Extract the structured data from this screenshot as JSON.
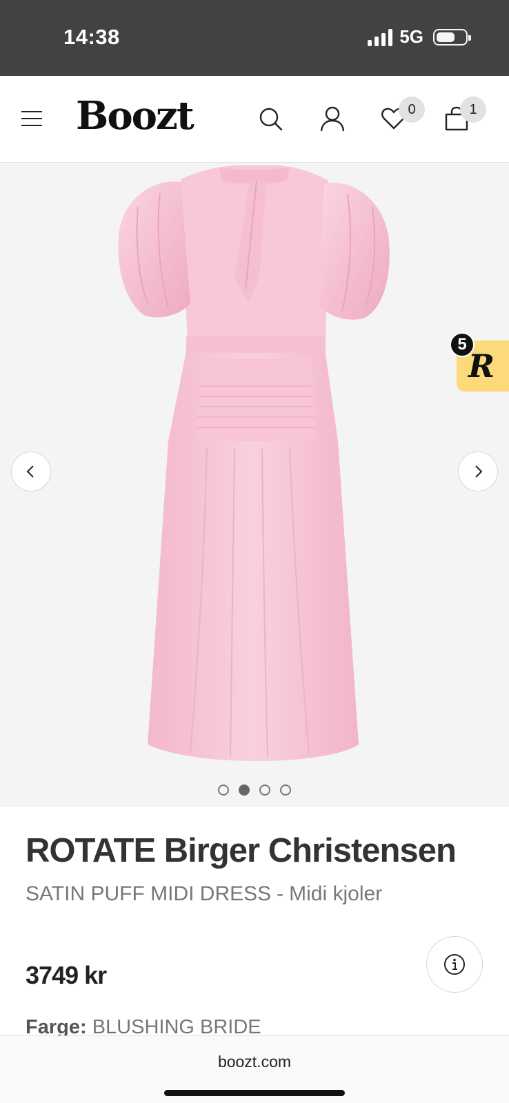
{
  "status_bar": {
    "time": "14:38",
    "network": "5G",
    "battery_level": 0.55
  },
  "header": {
    "logo": "Boozt",
    "wishlist_count": "0",
    "cart_count": "1"
  },
  "gallery": {
    "image_description_icon": "pink-satin-puff-sleeve-dress",
    "dots_total": 4,
    "active_index": 2,
    "reward_count": "5",
    "reward_letter": "R"
  },
  "product": {
    "brand": "ROTATE Birger Christensen",
    "name": "SATIN PUFF MIDI DRESS",
    "separator": "-",
    "category": "Midi kjoler",
    "price": "3749 kr",
    "color_label": "Farge:",
    "color_value": "BLUSHING BRIDE"
  },
  "browser": {
    "url": "boozt.com"
  },
  "colors": {
    "status_bar": "#424242",
    "gallery_bg": "#f4f4f4",
    "dress_pink": "#f7c6d6",
    "reward_yellow": "#fcd97a"
  }
}
